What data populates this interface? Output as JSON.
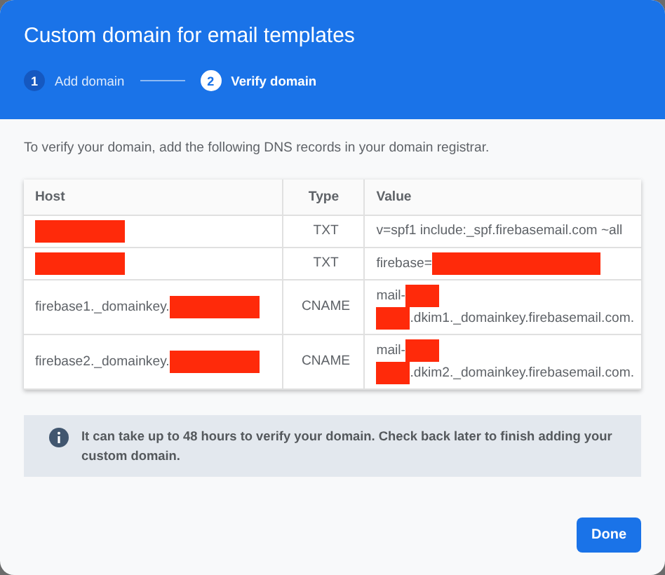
{
  "dialog": {
    "title": "Custom domain for email templates"
  },
  "steps": [
    {
      "number": "1",
      "label": "Add domain",
      "selected": false
    },
    {
      "number": "2",
      "label": "Verify domain",
      "selected": true
    }
  ],
  "intro": "To verify your domain, add the following DNS records in your domain registrar.",
  "table": {
    "columns": [
      "Host",
      "Type",
      "Value"
    ],
    "rows": [
      {
        "host": [
          [
            {
              "kind": "redaction"
            }
          ]
        ],
        "type": "TXT",
        "value": [
          [
            {
              "kind": "text",
              "text": "v=spf1 include:_spf.firebasemail.com ~all"
            }
          ]
        ]
      },
      {
        "host": [
          [
            {
              "kind": "redaction"
            }
          ]
        ],
        "type": "TXT",
        "value": [
          [
            {
              "kind": "text",
              "text": "firebase="
            },
            {
              "kind": "long_redaction"
            }
          ]
        ]
      },
      {
        "host": [
          [
            {
              "kind": "text",
              "text": "firebase1._domainkey."
            },
            {
              "kind": "redaction"
            }
          ]
        ],
        "type": "CNAME",
        "value": [
          [
            {
              "kind": "text",
              "text": "mail-"
            },
            {
              "kind": "short_redaction"
            }
          ],
          [
            {
              "kind": "short_redaction"
            },
            {
              "kind": "text",
              "text": ".dkim1._domainkey.firebasemail.com."
            }
          ]
        ]
      },
      {
        "host": [
          [
            {
              "kind": "text",
              "text": "firebase2._domainkey."
            },
            {
              "kind": "redaction"
            }
          ]
        ],
        "type": "CNAME",
        "value": [
          [
            {
              "kind": "text",
              "text": "mail-"
            },
            {
              "kind": "short_redaction"
            }
          ],
          [
            {
              "kind": "short_redaction"
            },
            {
              "kind": "text",
              "text": ".dkim2._domainkey.firebasemail.com."
            }
          ]
        ]
      }
    ]
  },
  "notice": "It can take up to 48 hours to verify your domain. Check back later to finish adding your custom domain.",
  "buttons": [
    "Done"
  ]
}
